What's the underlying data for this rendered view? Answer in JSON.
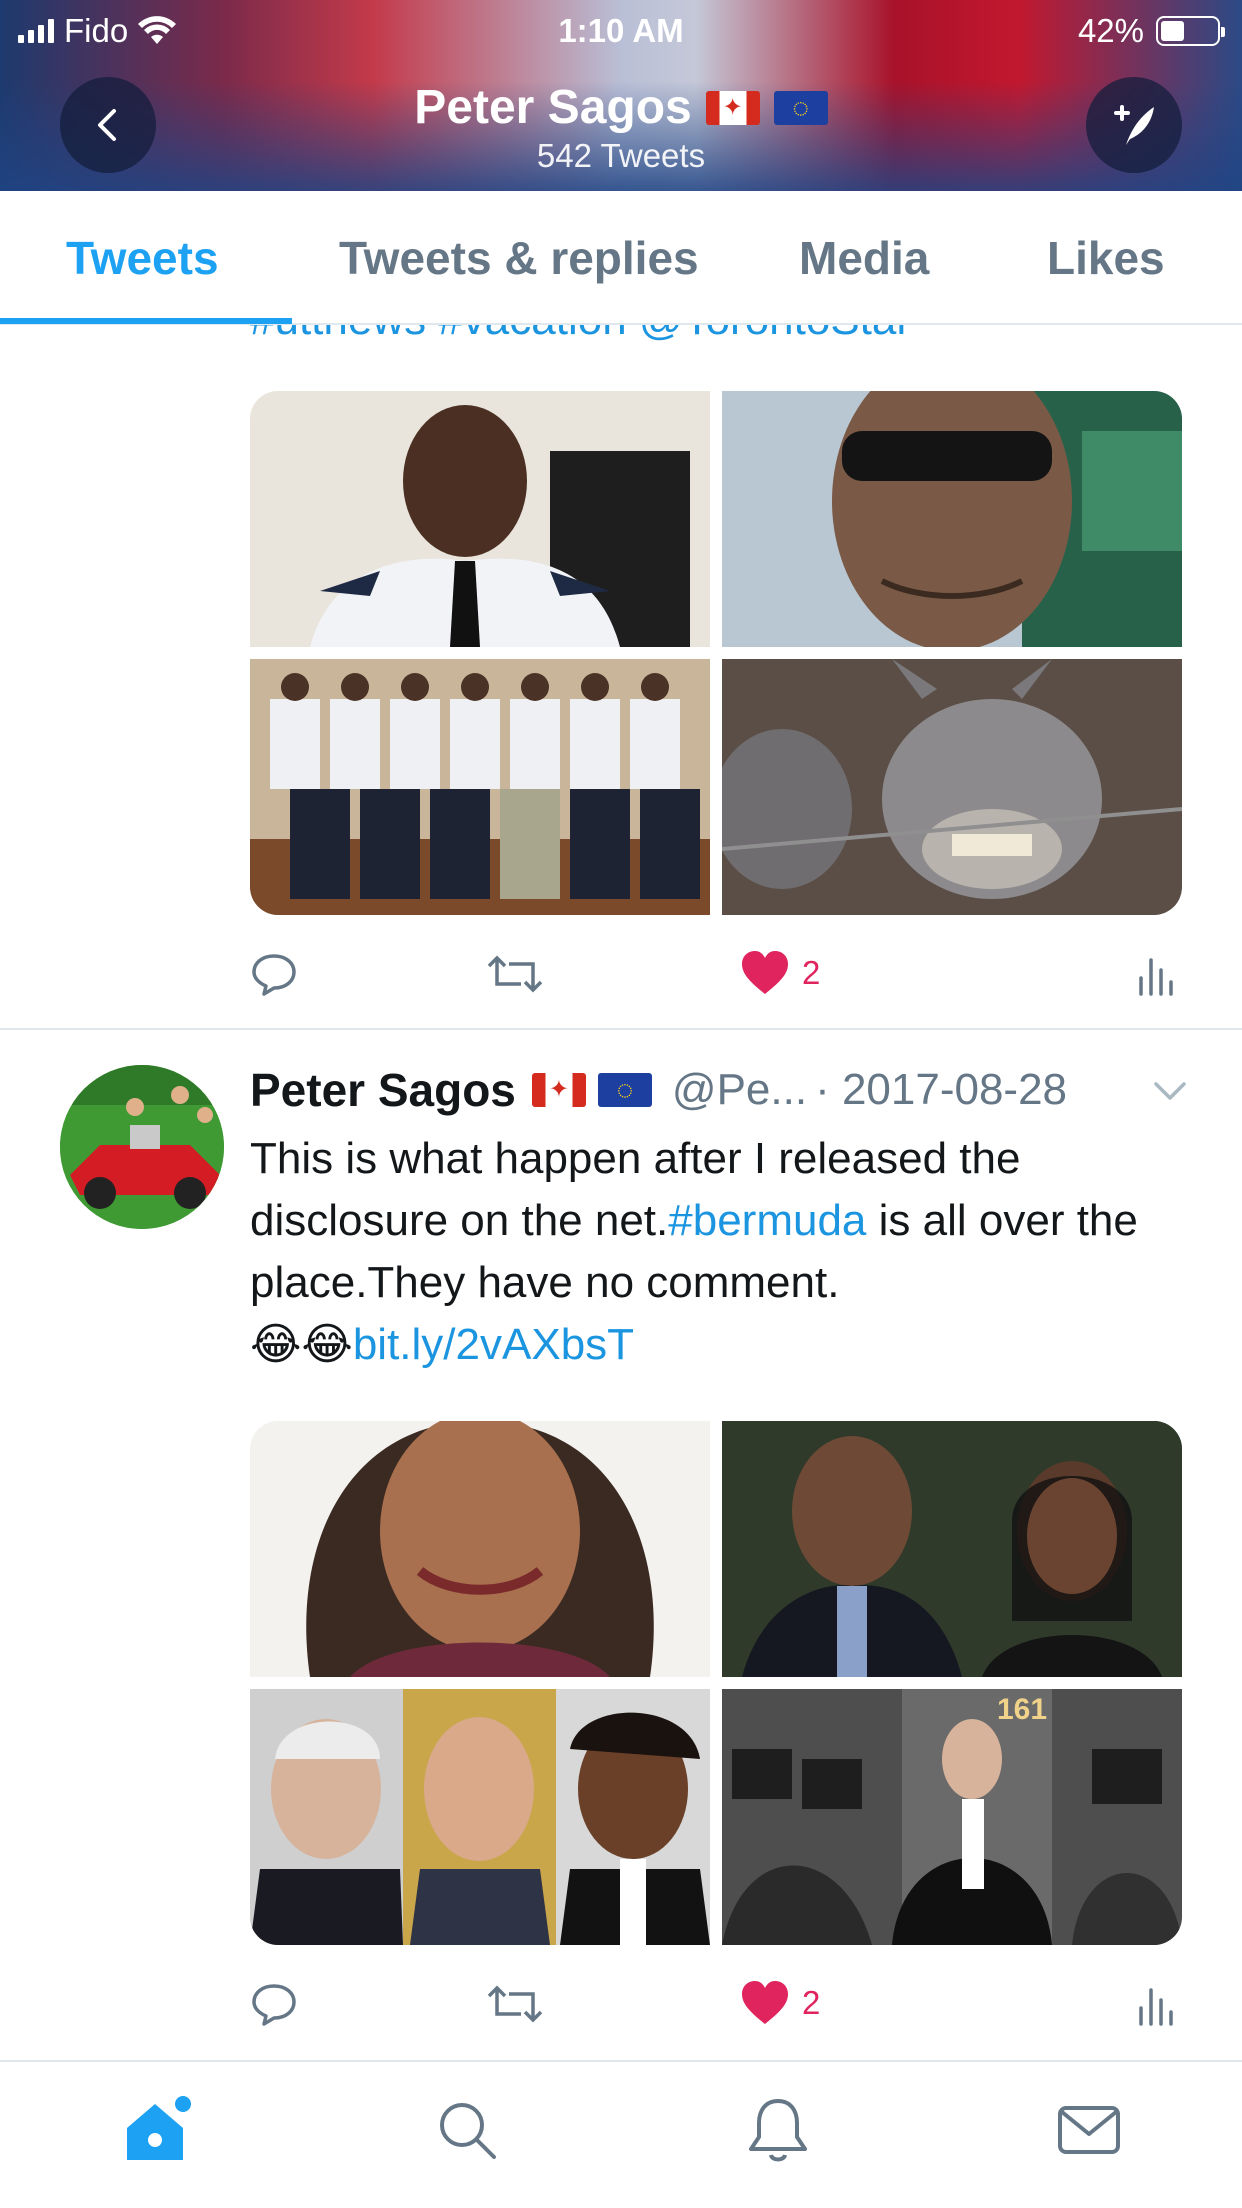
{
  "status_bar": {
    "carrier": "Fido",
    "time": "1:10 AM",
    "battery": "42%",
    "battery_level": 0.42
  },
  "header": {
    "name": "Peter Sagos",
    "tweet_count": "542 Tweets"
  },
  "tabs": [
    {
      "label": "Tweets",
      "active": true
    },
    {
      "label": "Tweets & replies",
      "active": false
    },
    {
      "label": "Media",
      "active": false
    },
    {
      "label": "Likes",
      "active": false
    }
  ],
  "feed": {
    "clipped_previous_text": "#uttnews #vacation @TorontoStar",
    "tweet1_actions": {
      "like_count": "2"
    },
    "tweet2": {
      "name": "Peter Sagos",
      "handle": "@Pe...",
      "date": "· 2017-08-28",
      "text_1": "This is what happen after I released the disclosure on the net.",
      "hashtag": "#bermuda",
      "text_2": " is all over the place.They have no comment.",
      "emoji": "😂😂",
      "link": "bit.ly/2vAXbsT",
      "photo_sign": "161",
      "like_count": "2"
    }
  },
  "colors": {
    "accent": "#1da1f2",
    "like": "#e0245e",
    "muted": "#657786"
  },
  "bottom_tabs": [
    "home-icon",
    "search-icon",
    "notifications-icon",
    "messages-icon"
  ]
}
